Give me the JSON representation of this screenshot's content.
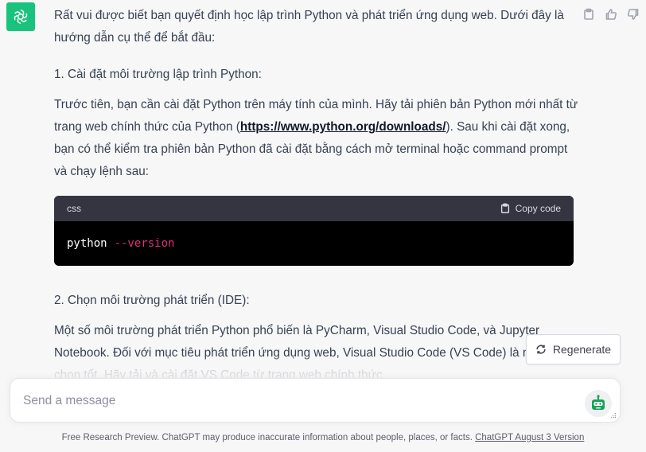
{
  "assistant": {
    "avatar_icon": "openai-logo-icon",
    "avatar_color": "#19c37d",
    "actions": [
      "clipboard-icon",
      "thumbs-up-icon",
      "thumbs-down-icon"
    ]
  },
  "message": {
    "intro": "Rất vui được biết bạn quyết định học lập trình Python và phát triển ứng dụng web. Dưới đây là hướng dẫn cụ thể để bắt đầu:",
    "section1": {
      "heading": "1. Cài đặt môi trường lập trình Python:",
      "text_before_link": "Trước tiên, bạn cần cài đặt Python trên máy tính của mình. Hãy tải phiên bản Python mới nhất từ trang web chính thức của Python (",
      "link_text": "https://www.python.org/downloads/",
      "text_after_link": "). Sau khi cài đặt xong, bạn có thể kiểm tra phiên bản Python đã cài đặt bằng cách mở terminal hoặc command prompt và chạy lệnh sau:"
    },
    "code": {
      "language": "css",
      "copy_label": "Copy code",
      "command": "python",
      "flag": "--version"
    },
    "section2": {
      "heading": "2. Chọn môi trường phát triển (IDE):",
      "text_main": "Một số môi trường phát triển Python phổ biến là PyCharm, Visual Studio Code, và Jupyter Notebook. Đối với mục tiêu phát triển ứng dụng web, Visual Studio Code (VS Code) là một",
      "text_faded": "lựa chọn tốt. Hãy tải và cài đặt VS Code từ trang web chính thức"
    }
  },
  "regenerate": {
    "label": "Regenerate",
    "icon": "refresh-icon"
  },
  "composer": {
    "placeholder": "Send a message",
    "bot_icon": "robot-assistant-icon",
    "bot_color": "#19a35a"
  },
  "footer": {
    "text": "Free Research Preview. ChatGPT may produce inaccurate information about people, places, or facts. ",
    "link": "ChatGPT August 3 Version"
  }
}
